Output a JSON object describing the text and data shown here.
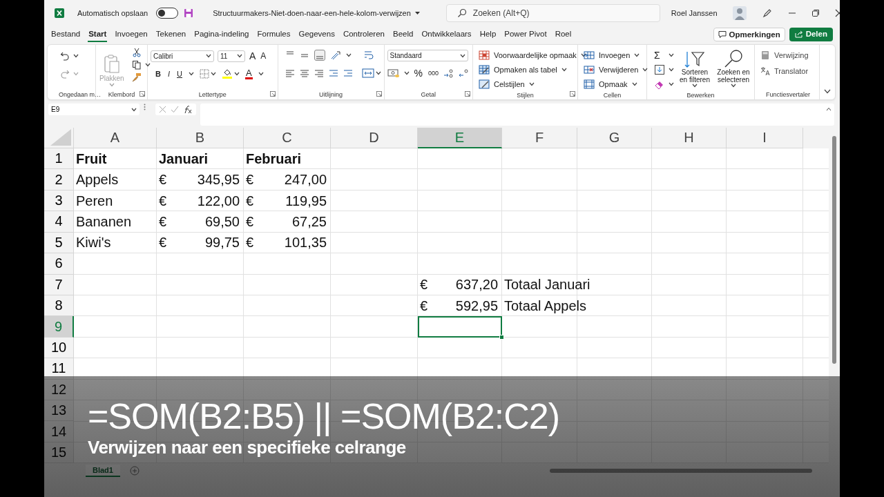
{
  "title_bar": {
    "autosave_label": "Automatisch opslaan",
    "autosave_on": false,
    "file_name": "Structuurmakers-Niet-doen-naar-een-hele-kolom-verwijzen",
    "search_placeholder": "Zoeken (Alt+Q)",
    "user_name": "Roel Janssen"
  },
  "menu_tabs": [
    {
      "label": "Bestand",
      "selected": false
    },
    {
      "label": "Start",
      "selected": true
    },
    {
      "label": "Invoegen",
      "selected": false
    },
    {
      "label": "Tekenen",
      "selected": false
    },
    {
      "label": "Pagina-indeling",
      "selected": false
    },
    {
      "label": "Formules",
      "selected": false
    },
    {
      "label": "Gegevens",
      "selected": false
    },
    {
      "label": "Controleren",
      "selected": false
    },
    {
      "label": "Beeld",
      "selected": false
    },
    {
      "label": "Ontwikkelaars",
      "selected": false
    },
    {
      "label": "Help",
      "selected": false
    },
    {
      "label": "Power Pivot",
      "selected": false
    },
    {
      "label": "Roel",
      "selected": false
    }
  ],
  "comments_button": "Opmerkingen",
  "share_button": "Delen",
  "ribbon": {
    "groups": [
      {
        "label": "Ongedaan m…",
        "kind": "undo",
        "has_launcher": false
      },
      {
        "label": "Klembord",
        "kind": "clipboard",
        "has_launcher": true,
        "paste_label": "Plakken",
        "paste_disabled": true
      },
      {
        "label": "Lettertype",
        "kind": "font",
        "has_launcher": true,
        "font_name": "Calibri",
        "font_size": "11",
        "grow_glyph": "A",
        "shrink_glyph": "A",
        "format_buttons": [
          "B",
          "I",
          "U"
        ],
        "color_glyph": "A"
      },
      {
        "label": "Uitlijning",
        "kind": "alignment",
        "has_launcher": true
      },
      {
        "label": "Getal",
        "kind": "number",
        "has_launcher": true,
        "format": "Standaard",
        "percent": "%",
        "thousands": "000"
      },
      {
        "label": "Stijlen",
        "kind": "list",
        "has_launcher": true,
        "items": [
          "Voorwaardelijke opmaak",
          "Opmaken als tabel",
          "Celstijlen"
        ]
      },
      {
        "label": "Cellen",
        "kind": "list",
        "has_launcher": false,
        "items": [
          "Invoegen",
          "Verwijderen",
          "Opmaak"
        ]
      },
      {
        "label": "Bewerken",
        "kind": "editing",
        "has_launcher": false,
        "sum_glyph": "Σ",
        "big_buttons": [
          "Sorteren en filteren",
          "Zoeken en selecteren"
        ]
      },
      {
        "label": "Functiesvertaler",
        "kind": "plain-list",
        "has_launcher": false,
        "items": [
          "Verwijzing",
          "Translator"
        ]
      }
    ]
  },
  "formula_bar": {
    "name_box": "E9"
  },
  "sheet": {
    "columns": [
      {
        "label": "A",
        "selected": false
      },
      {
        "label": "B",
        "selected": false
      },
      {
        "label": "C",
        "selected": false
      },
      {
        "label": "D",
        "selected": false
      },
      {
        "label": "E",
        "selected": true
      },
      {
        "label": "F",
        "selected": false
      },
      {
        "label": "G",
        "selected": false
      },
      {
        "label": "H",
        "selected": false
      },
      {
        "label": "I",
        "selected": false
      }
    ],
    "rows": [
      {
        "label": "1",
        "selected": false,
        "cells": {
          "A": {
            "kind": "text",
            "text": "Fruit",
            "bold": true
          },
          "B": {
            "kind": "text",
            "text": "Januari",
            "bold": true
          },
          "C": {
            "kind": "text",
            "text": "Februari",
            "bold": true
          }
        }
      },
      {
        "label": "2",
        "selected": false,
        "cells": {
          "A": {
            "kind": "text",
            "text": "Appels",
            "bold": false
          },
          "B": {
            "kind": "currency",
            "symbol": "€",
            "amount": "345,95"
          },
          "C": {
            "kind": "currency",
            "symbol": "€",
            "amount": "247,00"
          }
        }
      },
      {
        "label": "3",
        "selected": false,
        "cells": {
          "A": {
            "kind": "text",
            "text": "Peren",
            "bold": false
          },
          "B": {
            "kind": "currency",
            "symbol": "€",
            "amount": "122,00"
          },
          "C": {
            "kind": "currency",
            "symbol": "€",
            "amount": "119,95"
          }
        }
      },
      {
        "label": "4",
        "selected": false,
        "cells": {
          "A": {
            "kind": "text",
            "text": "Bananen",
            "bold": false
          },
          "B": {
            "kind": "currency",
            "symbol": "€",
            "amount": "69,50"
          },
          "C": {
            "kind": "currency",
            "symbol": "€",
            "amount": "67,25"
          }
        }
      },
      {
        "label": "5",
        "selected": false,
        "cells": {
          "A": {
            "kind": "text",
            "text": "Kiwi's",
            "bold": false
          },
          "B": {
            "kind": "currency",
            "symbol": "€",
            "amount": "99,75"
          },
          "C": {
            "kind": "currency",
            "symbol": "€",
            "amount": "101,35"
          }
        }
      },
      {
        "label": "6",
        "selected": false
      },
      {
        "label": "7",
        "selected": false,
        "cells": {
          "E": {
            "kind": "currency",
            "symbol": "€",
            "amount": "637,20"
          },
          "F": {
            "kind": "text",
            "text": "Totaal Januari",
            "bold": false
          }
        }
      },
      {
        "label": "8",
        "selected": false,
        "cells": {
          "E": {
            "kind": "currency",
            "symbol": "€",
            "amount": "592,95"
          },
          "F": {
            "kind": "text",
            "text": "Totaal Appels",
            "bold": false
          }
        }
      },
      {
        "label": "9",
        "selected": true
      },
      {
        "label": "10",
        "selected": false
      },
      {
        "label": "11",
        "selected": false
      },
      {
        "label": "12",
        "selected": false
      },
      {
        "label": "13",
        "selected": false
      },
      {
        "label": "14",
        "selected": false
      },
      {
        "label": "15",
        "selected": false
      }
    ],
    "sheet_tabs": [
      {
        "label": "Blad1",
        "selected": true
      }
    ]
  },
  "caption": {
    "formula": "=SOM(B2:B5) || =SOM(B2:C2)",
    "subtitle": "Verwijzen naar een specifieke celrange"
  }
}
